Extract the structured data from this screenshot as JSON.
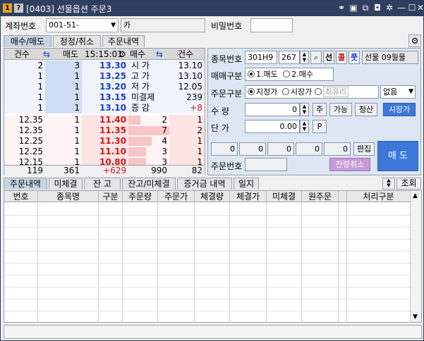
{
  "window": {
    "screen_no": "1",
    "help": "?",
    "title": "[0403] 선물옵션 주문3"
  },
  "account": {
    "label": "계좌번호",
    "number": "001-51-",
    "name": "카",
    "password_label": "비밀번호",
    "password": ""
  },
  "top_tabs": [
    {
      "label": "매수/매도"
    },
    {
      "label": "정정/취소"
    },
    {
      "label": "주문내역"
    }
  ],
  "hoga": {
    "header": {
      "qty": "건수",
      "sell_qty": "매도",
      "time": "15:15:01",
      "buy_qty": "매수",
      "qty2": "건수"
    },
    "sell_rows": [
      {
        "cnt": "2",
        "qty": "3",
        "price": "13.30",
        "lbl": "시   가",
        "val": "13.10"
      },
      {
        "cnt": "1",
        "qty": "1",
        "price": "13.25",
        "lbl": "고   가",
        "val": "13.10"
      },
      {
        "cnt": "1",
        "qty": "1",
        "price": "13.20",
        "lbl": "저   가",
        "val": "12.05"
      },
      {
        "cnt": "1",
        "qty": "1",
        "price": "13.15",
        "lbl": "미결제",
        "val": "239"
      },
      {
        "cnt": "1",
        "qty": "1",
        "price": "13.10",
        "lbl": "증   감",
        "val": "+8"
      }
    ],
    "buy_rows": [
      {
        "price": "11.40",
        "qty": "2",
        "cnt": "1",
        "lcnt": "12.35",
        "lq": "1"
      },
      {
        "price": "11.35",
        "qty": "7",
        "cnt": "2",
        "lcnt": "12.35",
        "lq": "1"
      },
      {
        "price": "11.30",
        "qty": "4",
        "cnt": "1",
        "lcnt": "12.25",
        "lq": "1"
      },
      {
        "price": "11.10",
        "qty": "3",
        "cnt": "1",
        "lcnt": "12.25",
        "lq": "1"
      },
      {
        "price": "10.80",
        "qty": "3",
        "cnt": "1",
        "lcnt": "12.15",
        "lq": "1"
      }
    ],
    "buy_qty_frac": [
      0.29,
      1.0,
      0.57,
      0.43,
      0.43
    ],
    "footer": {
      "c1": "119",
      "c2": "361",
      "c3": "+629",
      "c4": "990",
      "c5": "82"
    }
  },
  "order": {
    "code_label": "종목번호",
    "code": "301H9",
    "strike": "267",
    "btn_future": "선",
    "btn_call": "콜",
    "btn_put": "풋",
    "product_name": "선물 09월물",
    "side_label": "매매구분",
    "side_sell": "1.매도",
    "side_buy": "2.매수",
    "type_label": "주문구분",
    "type_limit": "지정가",
    "type_market": "시장가",
    "type_best": "최유리",
    "cond": "없음",
    "qty_label": "수     량",
    "qty": "0",
    "btn_ju": "주",
    "btn_possible": "가능",
    "btn_clear": "청산",
    "btn_market": "시장가",
    "price_label": "단     가",
    "price": "0.00",
    "btn_p": "P",
    "boxes": [
      "0",
      "0",
      "0",
      "0",
      "0"
    ],
    "btn_edit": "편집",
    "orderno_label": "주문번호",
    "btn_cancel_rest": "잔량취소",
    "btn_submit": "매   도"
  },
  "bottom_tabs": [
    {
      "label": "주문내역"
    },
    {
      "label": "미체결"
    },
    {
      "label": "잔 고"
    },
    {
      "label": "잔고/미체결"
    },
    {
      "label": "증거금 내역"
    },
    {
      "label": "일지"
    }
  ],
  "btn_refresh": "조회",
  "grid_headers": [
    "번호",
    "종목명",
    "구분",
    "주문량",
    "주문가",
    "체결량",
    "체결가",
    "미체결",
    "원주문",
    "",
    "처리구분"
  ]
}
